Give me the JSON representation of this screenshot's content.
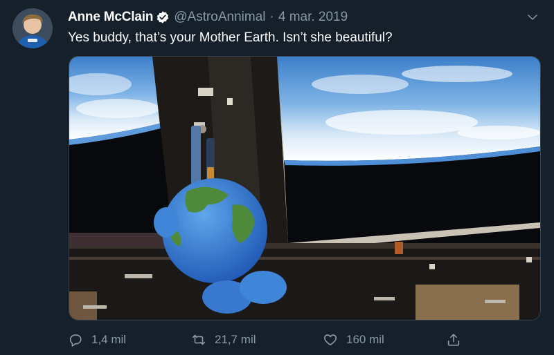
{
  "tweet": {
    "author_name": "Anne McClain",
    "handle": "@AstroAnnimal",
    "separator": "·",
    "date": "4 mar. 2019",
    "text": "Yes buddy, that’s your Mother Earth. Isn’t she beautiful?",
    "verified": true,
    "menu_icon": "chevron-down-icon"
  },
  "actions": {
    "reply": {
      "icon": "reply-icon",
      "count": "1,4 mil"
    },
    "retweet": {
      "icon": "retweet-icon",
      "count": "21,7 mil"
    },
    "like": {
      "icon": "heart-icon",
      "count": "160 mil"
    },
    "share": {
      "icon": "share-icon"
    }
  },
  "colors": {
    "background": "#15202b",
    "primary_text": "#ffffff",
    "secondary_text": "#8899a6",
    "verified_badge": "#ffffff",
    "border": "#38444d"
  }
}
